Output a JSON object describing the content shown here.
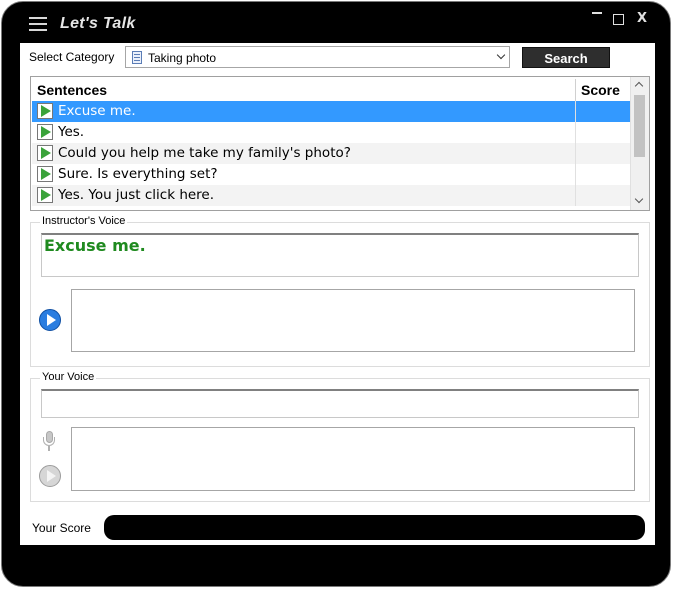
{
  "app": {
    "title": "Let's Talk"
  },
  "window_controls": {
    "close_label": "X"
  },
  "category": {
    "label": "Select Category",
    "value": "Taking photo"
  },
  "search": {
    "label": "Search"
  },
  "sentences": {
    "col_sentence": "Sentences",
    "col_score": "Score",
    "rows": [
      {
        "text": "Excuse me.",
        "score": "",
        "selected": true
      },
      {
        "text": "Yes.",
        "score": ""
      },
      {
        "text": "Could you help me take my family's photo?",
        "score": ""
      },
      {
        "text": "Sure. Is everything set?",
        "score": ""
      },
      {
        "text": "Yes. You just click here.",
        "score": ""
      }
    ]
  },
  "instructor": {
    "legend": "Instructor's Voice",
    "text": "Excuse me."
  },
  "your_voice": {
    "legend": "Your Voice",
    "text": ""
  },
  "score": {
    "label": "Your Score"
  },
  "icons": {
    "menu": "hamburger-icon",
    "sentence_play": "play-icon",
    "instructor_play": "play-circle-icon",
    "mic": "microphone-icon",
    "your_play": "play-circle-icon",
    "category": "document-icon"
  },
  "colors": {
    "selection": "#3399ff",
    "instructor_text": "#1f8a1f",
    "play_green": "#3aa33a",
    "play_blue": "#2a7de0"
  }
}
